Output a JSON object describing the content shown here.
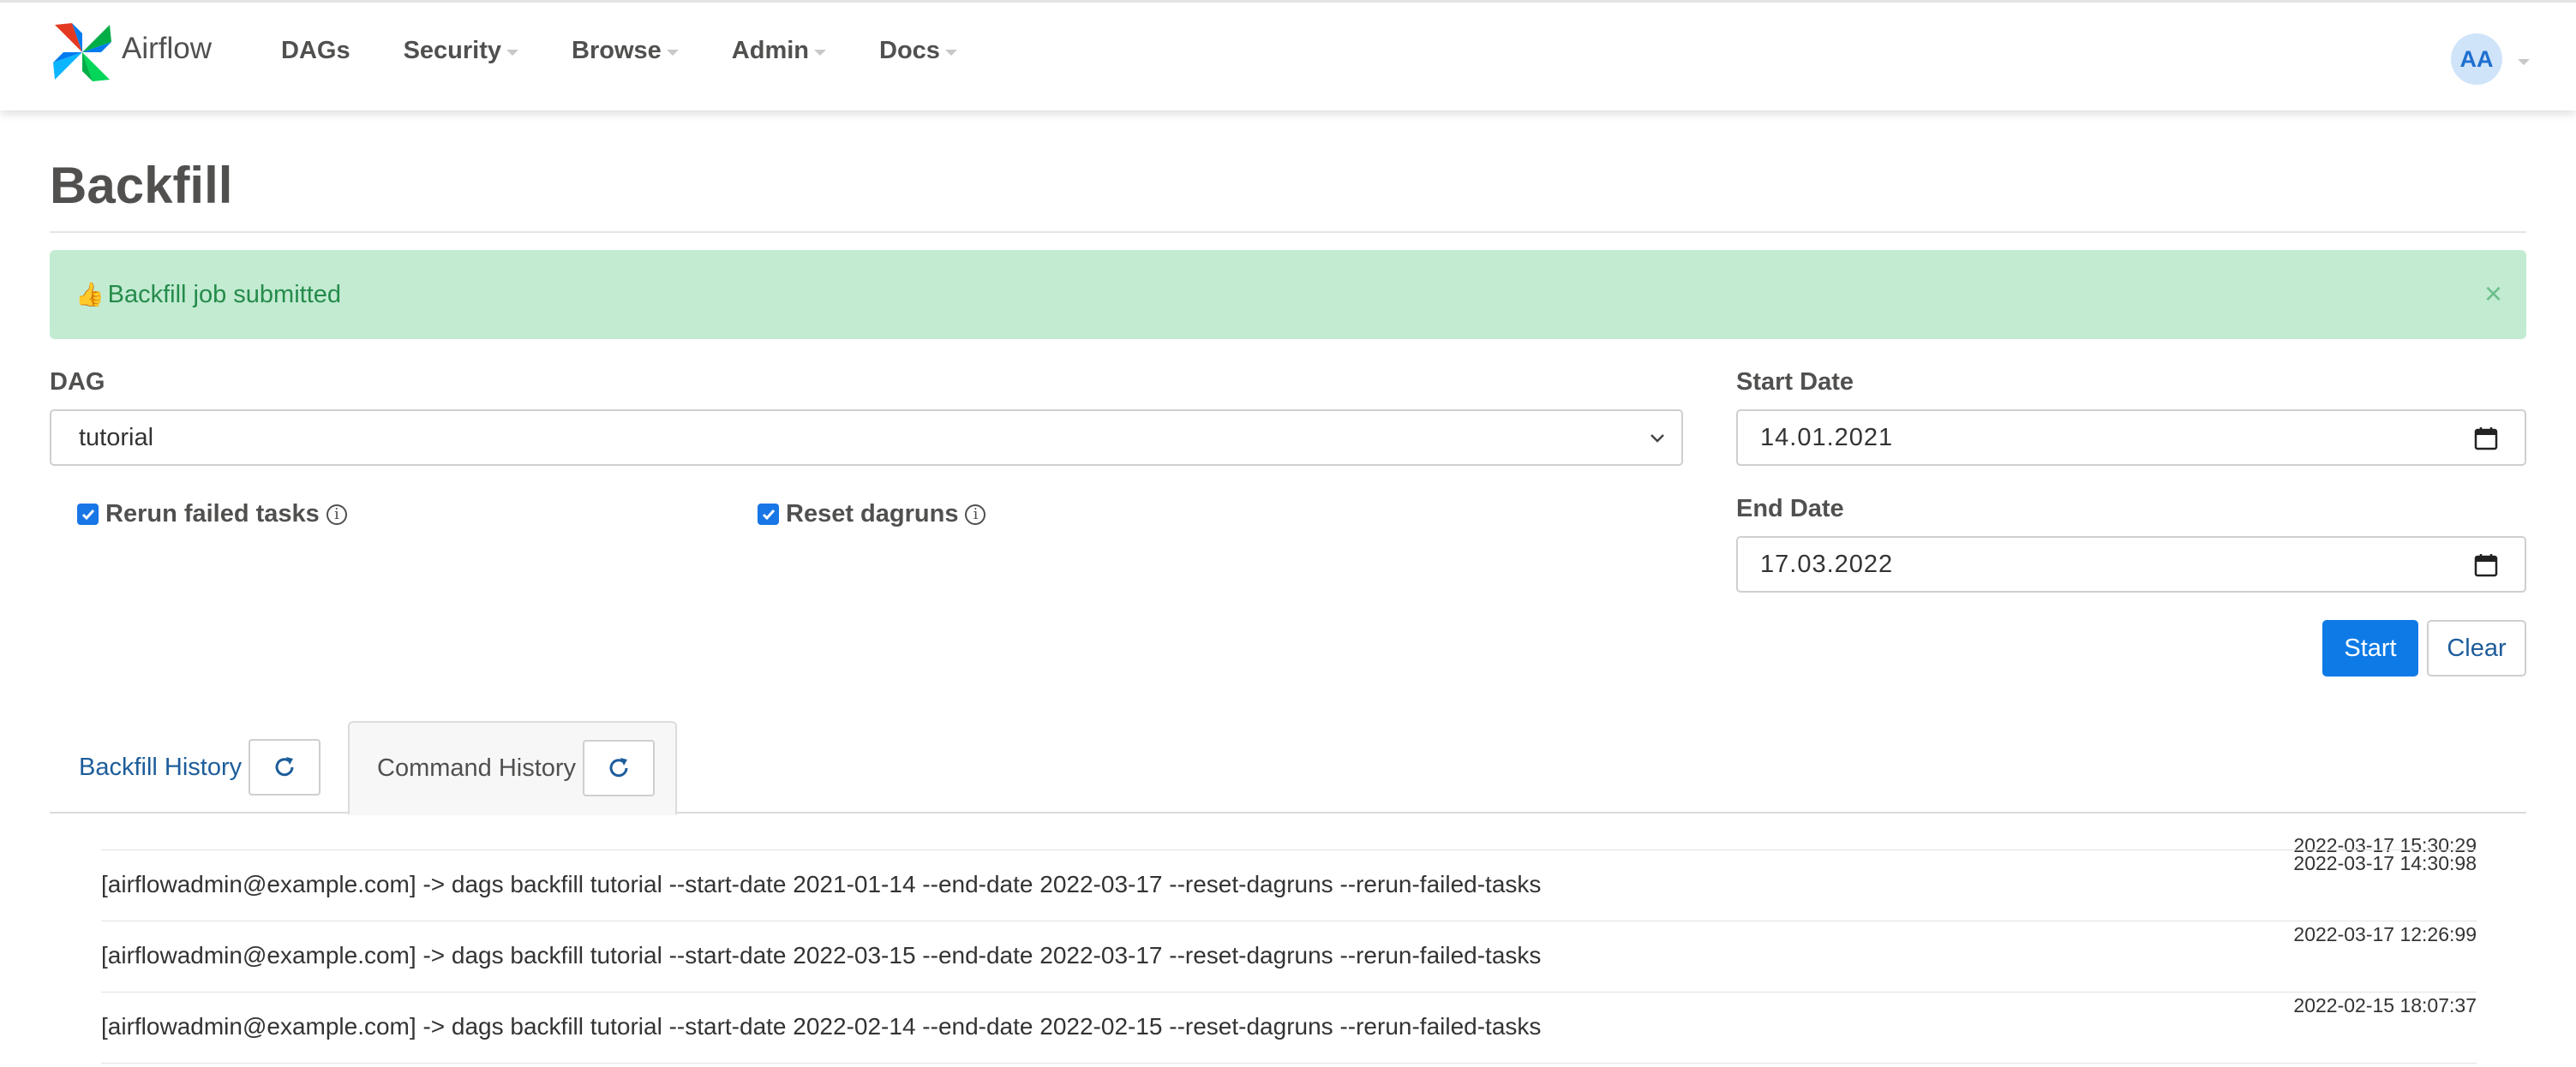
{
  "navbar": {
    "brand": "Airflow",
    "items": [
      {
        "label": "DAGs",
        "dropdown": false
      },
      {
        "label": "Security",
        "dropdown": true
      },
      {
        "label": "Browse",
        "dropdown": true
      },
      {
        "label": "Admin",
        "dropdown": true
      },
      {
        "label": "Docs",
        "dropdown": true
      }
    ],
    "user_initials": "AA"
  },
  "page": {
    "title": "Backfill"
  },
  "alert": {
    "icon": "👍",
    "message": "Backfill job submitted",
    "close": "×"
  },
  "form": {
    "dag_label": "DAG",
    "dag_value": "tutorial",
    "rerun_label": "Rerun failed tasks",
    "rerun_checked": true,
    "reset_label": "Reset dagruns",
    "reset_checked": true,
    "start_date_label": "Start Date",
    "start_date_value": "14.01.2021",
    "end_date_label": "End Date",
    "end_date_value": "17.03.2022",
    "start_button": "Start",
    "clear_button": "Clear"
  },
  "tabs": [
    {
      "label": "Backfill History",
      "active": false
    },
    {
      "label": "Command History",
      "active": true
    }
  ],
  "history": {
    "header_time": "2022-03-17 15:30:29",
    "rows": [
      {
        "command": "[airflowadmin@example.com] -> dags backfill tutorial --start-date 2021-01-14 --end-date 2022-03-17 --reset-dagruns --rerun-failed-tasks",
        "time": "2022-03-17 14:30:98"
      },
      {
        "command": "[airflowadmin@example.com] -> dags backfill tutorial --start-date 2022-03-15 --end-date 2022-03-17 --reset-dagruns --rerun-failed-tasks",
        "time": "2022-03-17 12:26:99"
      },
      {
        "command": "[airflowadmin@example.com] -> dags backfill tutorial --start-date 2022-02-14 --end-date 2022-02-15 --reset-dagruns --rerun-failed-tasks",
        "time": "2022-02-15 18:07:37"
      }
    ]
  },
  "colors": {
    "primary": "#0e7ae6",
    "alert_bg": "#c2ebd2",
    "alert_text": "#248b4a",
    "link": "#1d5d9b"
  },
  "icons": [
    "airflow-logo-icon",
    "chevron-down-icon",
    "calendar-icon",
    "info-icon",
    "refresh-icon",
    "close-icon",
    "thumbs-up-icon"
  ]
}
